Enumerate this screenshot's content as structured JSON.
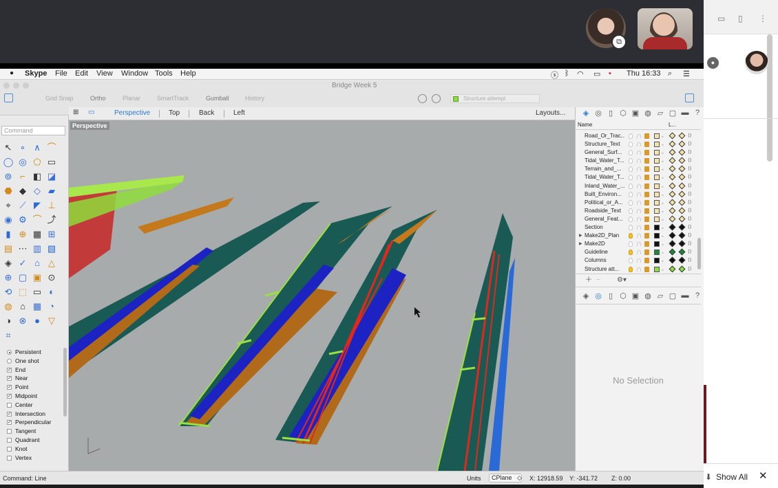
{
  "menubar": {
    "app": "Skype",
    "items": [
      "File",
      "Edit",
      "View",
      "Window",
      "Tools",
      "Help"
    ],
    "clock": "Thu 16:33"
  },
  "window": {
    "title": "Bridge Week 5"
  },
  "toolbar": {
    "options": [
      "Grid Snap",
      "Ortho",
      "Planar",
      "SmartTrack",
      "Gumball",
      "History"
    ],
    "current_layer": "Structure attempt"
  },
  "command": {
    "placeholder": "Command",
    "last_command": "Command: Line"
  },
  "viewport_tabs": {
    "tabs": [
      "Perspective",
      "Top",
      "Back",
      "Left"
    ],
    "active": "Perspective",
    "layouts": "Layouts..."
  },
  "viewport": {
    "label": "Perspective"
  },
  "snaps": [
    {
      "label": "Persistent",
      "type": "radio",
      "on": true
    },
    {
      "label": "One shot",
      "type": "radio",
      "on": false
    },
    {
      "label": "End",
      "type": "check",
      "on": true
    },
    {
      "label": "Near",
      "type": "check",
      "on": true
    },
    {
      "label": "Point",
      "type": "check",
      "on": true
    },
    {
      "label": "Midpoint",
      "type": "check",
      "on": true
    },
    {
      "label": "Center",
      "type": "check",
      "on": false
    },
    {
      "label": "Intersection",
      "type": "check",
      "on": true
    },
    {
      "label": "Perpendicular",
      "type": "check",
      "on": true
    },
    {
      "label": "Tangent",
      "type": "check",
      "on": false
    },
    {
      "label": "Quadrant",
      "type": "check",
      "on": false
    },
    {
      "label": "Knot",
      "type": "check",
      "on": false
    },
    {
      "label": "Vertex",
      "type": "check",
      "on": false
    }
  ],
  "layers": {
    "header": {
      "name": "Name",
      "col": "L..."
    },
    "rows": [
      {
        "name": "Road_Or_Trac...",
        "color": "#f3e3b0",
        "bulb": false,
        "expand": false
      },
      {
        "name": "Structure_Text",
        "color": "#f3e3b0",
        "bulb": false,
        "expand": false
      },
      {
        "name": "General_Surf...",
        "color": "#f3e3b0",
        "bulb": false,
        "expand": false
      },
      {
        "name": "Tidal_Water_T...",
        "color": "#f3e3b0",
        "bulb": false,
        "expand": false
      },
      {
        "name": "Terrain_and_...",
        "color": "#f3e3b0",
        "bulb": false,
        "expand": false
      },
      {
        "name": "Tidal_Water_T...",
        "color": "#f3e3b0",
        "bulb": false,
        "expand": false
      },
      {
        "name": "Inland_Water_...",
        "color": "#f3e3b0",
        "bulb": false,
        "expand": false
      },
      {
        "name": "Built_Environ...",
        "color": "#f3e3b0",
        "bulb": false,
        "expand": false
      },
      {
        "name": "Political_or_A...",
        "color": "#f3e3b0",
        "bulb": false,
        "expand": false
      },
      {
        "name": "Roadside_Text",
        "color": "#f3e3b0",
        "bulb": false,
        "expand": false
      },
      {
        "name": "General_Feat...",
        "color": "#f3e3b0",
        "bulb": false,
        "expand": false
      },
      {
        "name": "Section",
        "color": "#111111",
        "bulb": false,
        "expand": false
      },
      {
        "name": "Make2D_Plan",
        "color": "#111111",
        "bulb": true,
        "expand": true
      },
      {
        "name": "Make2D",
        "color": "#111111",
        "bulb": false,
        "expand": true
      },
      {
        "name": "Guideline",
        "color": "#1a8a3a",
        "bulb": true,
        "expand": false
      },
      {
        "name": "Columns",
        "color": "#111111",
        "bulb": false,
        "expand": false
      },
      {
        "name": "Structure att...",
        "color": "#8ddc45",
        "bulb": true,
        "expand": false
      }
    ]
  },
  "properties": {
    "empty_text": "No Selection"
  },
  "status": {
    "units": "Units",
    "cplane": "CPlane",
    "x": "X: 12918.59",
    "y": "Y: -341.72",
    "z": "Z: 0.00"
  },
  "browser": {
    "show_all": "Show All"
  }
}
